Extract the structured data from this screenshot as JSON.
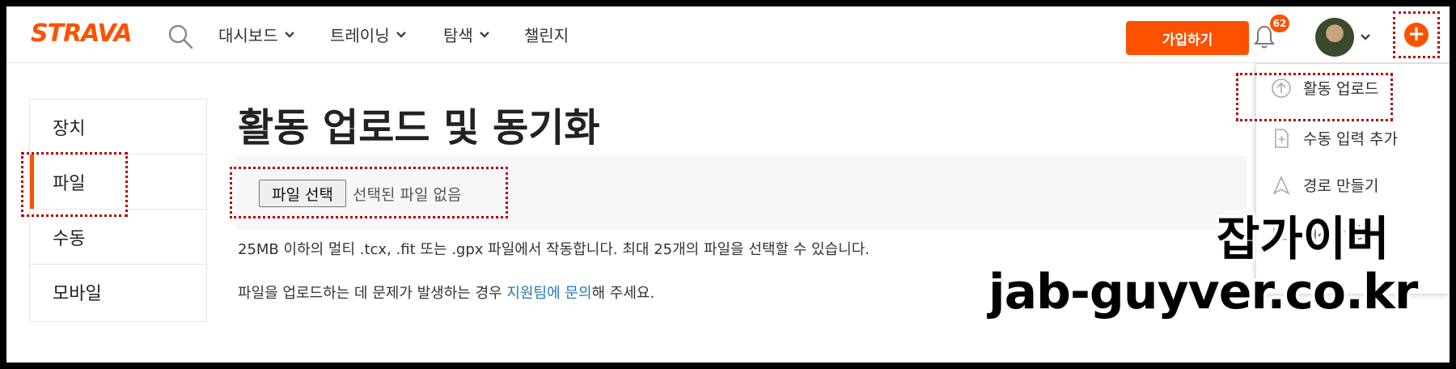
{
  "header": {
    "logo": "STRAVA",
    "nav": [
      {
        "label": "대시보드",
        "has_dropdown": true
      },
      {
        "label": "트레이닝",
        "has_dropdown": true
      },
      {
        "label": "탐색",
        "has_dropdown": true
      },
      {
        "label": "챌린지",
        "has_dropdown": false
      }
    ],
    "signup_label": "가입하기",
    "notification_count": "62",
    "brand_color": "#fc5200"
  },
  "sidebar": {
    "items": [
      {
        "label": "장치"
      },
      {
        "label": "파일",
        "active": true
      },
      {
        "label": "수동"
      },
      {
        "label": "모바일"
      }
    ]
  },
  "main": {
    "title": "활동 업로드 및 동기화",
    "file_button": "파일 선택",
    "file_status": "선택된 파일 없음",
    "description": "25MB 이하의 멀티 .tcx, .fit 또는 .gpx 파일에서 작동합니다. 최대 25개의 파일을 선택할 수 있습니다.",
    "help_prefix": "파일을 업로드하는 데 문제가 발생하는 경우 ",
    "help_link": "지원팀에 문의",
    "help_suffix": "해 주세요."
  },
  "dropdown": {
    "items": [
      {
        "label": "활동 업로드",
        "icon": "upload-icon"
      },
      {
        "label": "수동 입력 추가",
        "icon": "add-file-icon"
      },
      {
        "label": "경로 만들기",
        "icon": "route-icon"
      },
      {
        "label": "게시물 생성",
        "icon": "post-icon"
      }
    ]
  },
  "watermark": {
    "line1": "잡가이버",
    "line2": "jab-guyver.co.kr"
  }
}
